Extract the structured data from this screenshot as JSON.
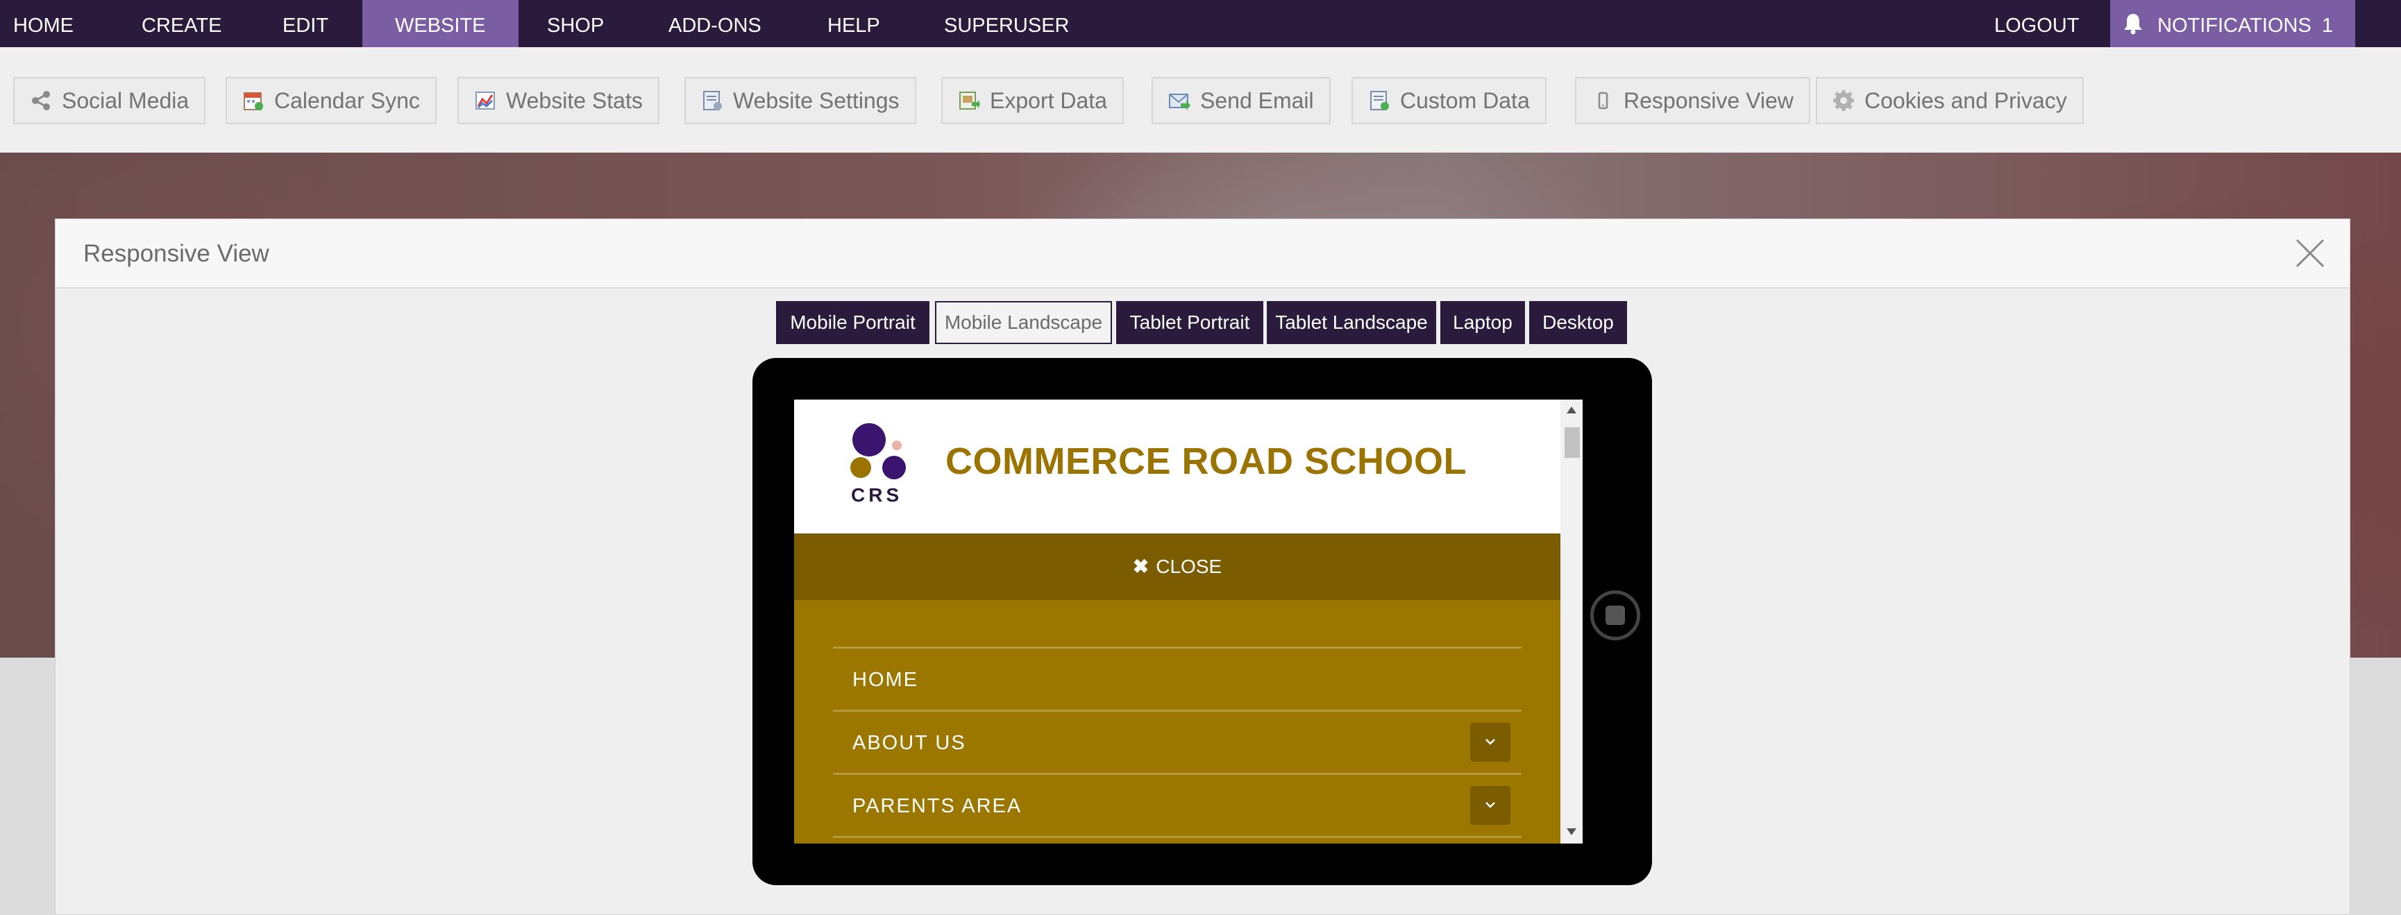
{
  "topnav": {
    "items": [
      "HOME",
      "CREATE",
      "EDIT",
      "WEBSITE",
      "SHOP",
      "ADD-ONS",
      "HELP",
      "SUPERUSER"
    ],
    "active": "WEBSITE",
    "logout": "LOGOUT",
    "notifications_label": "NOTIFICATIONS",
    "notifications_count": "1"
  },
  "toolbar": {
    "items": [
      {
        "label": "Social Media",
        "icon": "share-icon"
      },
      {
        "label": "Calendar Sync",
        "icon": "calendar-icon"
      },
      {
        "label": "Website Stats",
        "icon": "chart-icon"
      },
      {
        "label": "Website Settings",
        "icon": "settings-doc-icon"
      },
      {
        "label": "Export Data",
        "icon": "export-icon"
      },
      {
        "label": "Send Email",
        "icon": "email-icon"
      },
      {
        "label": "Custom Data",
        "icon": "custom-data-icon"
      },
      {
        "label": "Responsive View",
        "icon": "mobile-icon"
      },
      {
        "label": "Cookies and Privacy",
        "icon": "cookie-gear-icon"
      }
    ]
  },
  "modal": {
    "title": "Responsive View",
    "devices": [
      "Mobile Portrait",
      "Mobile Landscape",
      "Tablet Portrait",
      "Tablet Landscape",
      "Laptop",
      "Desktop"
    ],
    "selected_device": "Mobile Landscape"
  },
  "site": {
    "logo_text": "CRS",
    "school_name": "COMMERCE ROAD SCHOOL",
    "close_label": "CLOSE",
    "menu": [
      "HOME",
      "ABOUT US",
      "PARENTS AREA"
    ]
  },
  "colors": {
    "nav_bg": "#2a1b3d",
    "nav_active": "#7b5da3",
    "school_gold": "#9b7300",
    "close_bar": "#7c5c00",
    "menu_bg": "#9b7700"
  }
}
